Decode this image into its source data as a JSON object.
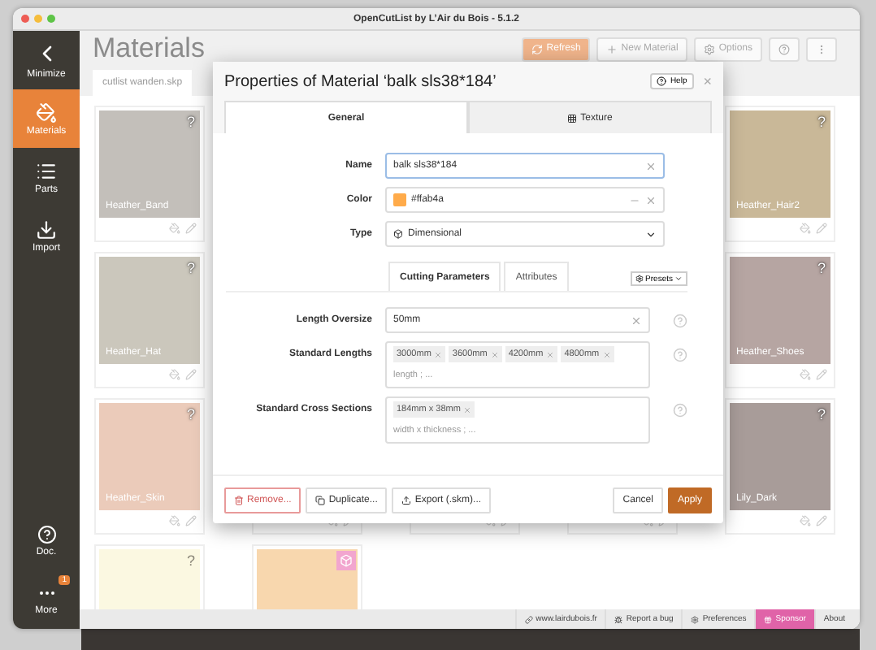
{
  "window": {
    "title": "OpenCutList by L’Air du Bois - 5.1.2"
  },
  "sidebar": {
    "items": [
      {
        "label": "Minimize",
        "selected": false
      },
      {
        "label": "Materials",
        "selected": true
      },
      {
        "label": "Parts",
        "selected": false
      },
      {
        "label": "Import",
        "selected": false
      }
    ],
    "bottom_items": [
      {
        "label": "Doc."
      },
      {
        "label": "More",
        "badge": "1"
      }
    ]
  },
  "header": {
    "title": "Materials",
    "buttons": [
      {
        "label": "Refresh",
        "kind": "primary"
      },
      {
        "label": "New Material",
        "kind": "plus"
      },
      {
        "label": "Options",
        "kind": "gear"
      },
      {
        "kind": "help"
      },
      {
        "kind": "dots"
      }
    ]
  },
  "file_tab": {
    "label": "cutlist wanden.skp"
  },
  "cards": [
    {
      "kind": "swatch",
      "name": "Heather_Band",
      "mark": "?",
      "color": "#c3bfba"
    },
    {
      "kind": "hidden"
    },
    {
      "kind": "hidden"
    },
    {
      "kind": "hidden"
    },
    {
      "kind": "swatch",
      "name": "Heather_Hair2",
      "mark": "?",
      "color": "#c9b898"
    },
    {
      "kind": "swatch",
      "name": "Heather_Hat",
      "mark": "?",
      "color": "#cbc7bc"
    },
    {
      "kind": "hidden"
    },
    {
      "kind": "hidden"
    },
    {
      "kind": "hidden"
    },
    {
      "kind": "swatch",
      "name": "Heather_Shoes",
      "mark": "?",
      "color": "#b6a5a2"
    },
    {
      "kind": "swatch",
      "name": "Heather_Skin",
      "mark": "?",
      "color": "#ebcbba"
    },
    {
      "kind": "covered"
    },
    {
      "kind": "covered"
    },
    {
      "kind": "covered"
    },
    {
      "kind": "swatch",
      "name": "Lily_Dark",
      "mark": "?",
      "color": "#a89c99"
    },
    {
      "kind": "partial",
      "mark": "?",
      "color": "#fbf8e1"
    },
    {
      "kind": "partial",
      "color": "#f8d7ae",
      "badge": true
    }
  ],
  "dialog": {
    "title": "Properties of Material ‘balk sls38*184’",
    "help": "Help",
    "close": "×",
    "tabs": [
      {
        "label": "General",
        "selected": true,
        "icon": false
      },
      {
        "label": "Texture",
        "selected": false,
        "icon": true
      }
    ],
    "name": {
      "label": "Name",
      "value": "balk sls38*184"
    },
    "color": {
      "label": "Color",
      "value": "#ffab4a"
    },
    "type": {
      "label": "Type",
      "value": "Dimensional"
    },
    "subtabs": [
      {
        "label": "Cutting Parameters",
        "selected": true
      },
      {
        "label": "Attributes",
        "selected": false
      }
    ],
    "presets": "Presets",
    "length_oversize": {
      "label": "Length Oversize",
      "value": "50mm"
    },
    "standard_lengths": {
      "label": "Standard Lengths",
      "tags": [
        "3000mm",
        "3600mm",
        "4200mm",
        "4800mm"
      ],
      "placeholder": "length ; ..."
    },
    "standard_cross_sections": {
      "label": "Standard Cross Sections",
      "tags": [
        "184mm x 38mm"
      ],
      "placeholder": "width x thickness ; ..."
    },
    "buttons": [
      {
        "label": "Remove...",
        "kind": "danger"
      },
      {
        "label": "Duplicate...",
        "kind": "copy"
      },
      {
        "label": "Export (.skm)...",
        "kind": "export"
      },
      {
        "label": "Cancel",
        "kind": "plain"
      },
      {
        "label": "Apply",
        "kind": "primary"
      }
    ]
  },
  "status_bar": [
    {
      "label": "www.lairdubois.fr",
      "kind": "link"
    },
    {
      "label": "Report a bug",
      "kind": "bug"
    },
    {
      "label": "Preferences",
      "kind": "gear"
    },
    {
      "label": "Sponsor",
      "kind": "sponsor"
    },
    {
      "label": "About",
      "kind": "plain"
    }
  ]
}
